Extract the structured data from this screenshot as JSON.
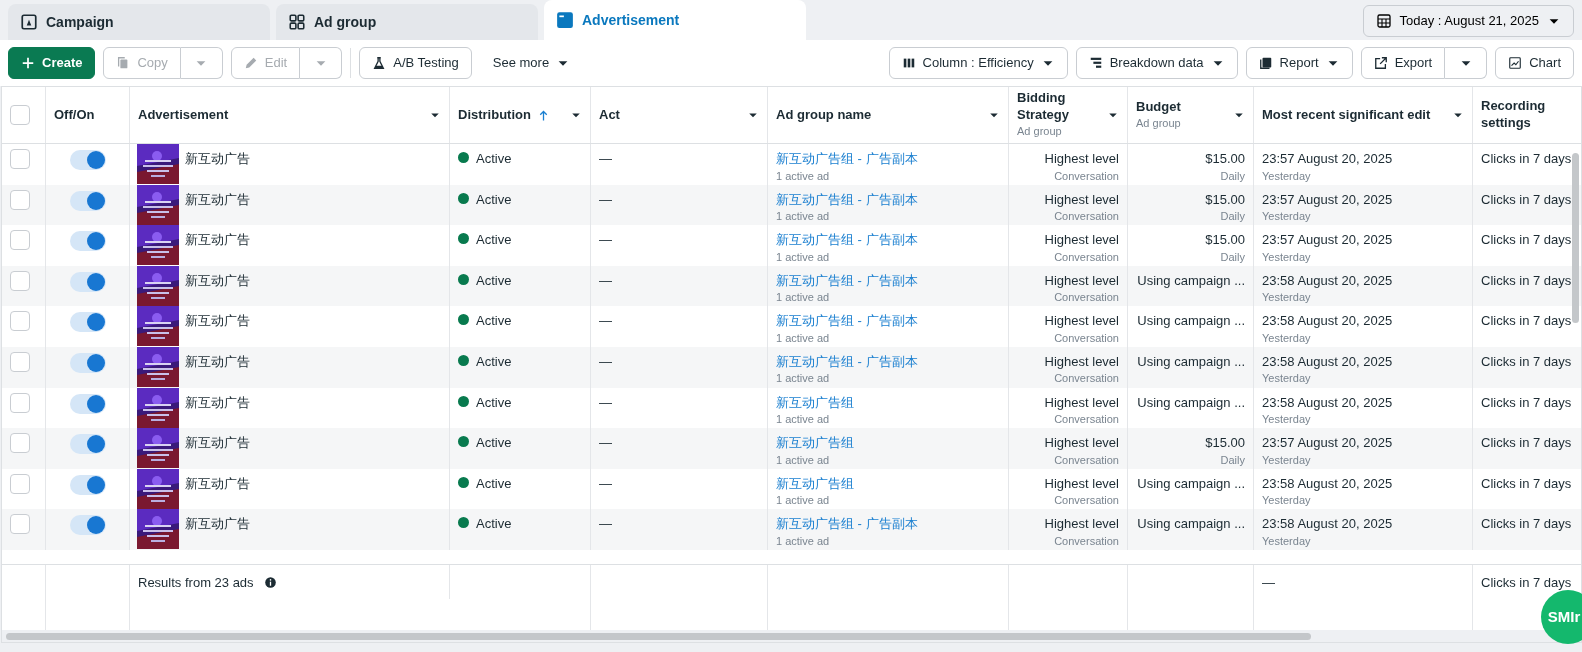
{
  "tabs": [
    {
      "label": "Campaign",
      "selected": false
    },
    {
      "label": "Ad group",
      "selected": false
    },
    {
      "label": "Advertisement",
      "selected": true
    }
  ],
  "date_button": {
    "label": "Today : August 21, 2025"
  },
  "toolbar_left": [
    {
      "label": "Create",
      "disabled": false
    },
    {
      "label": "Copy",
      "disabled": true
    },
    {
      "label": "Edit",
      "disabled": true
    },
    {
      "label": "A/B Testing",
      "disabled": false
    },
    {
      "label": "See more",
      "disabled": false
    }
  ],
  "toolbar_right": [
    {
      "label": "Column : Efficiency",
      "disabled": false
    },
    {
      "label": "Breakdown data",
      "disabled": false
    },
    {
      "label": "Report",
      "disabled": false
    },
    {
      "label": "Export",
      "disabled": false
    },
    {
      "label": "Chart",
      "disabled": false
    }
  ],
  "table": {
    "select_all": {
      "selected": false
    },
    "columns": [
      {
        "label": "Off/On",
        "dropdown": false
      },
      {
        "label": "Advertisement",
        "dropdown": true
      },
      {
        "label": "Distribution",
        "dropdown": true,
        "sorted": true
      },
      {
        "label": "Act",
        "dropdown": true
      },
      {
        "label": "Ad group name",
        "dropdown": true
      },
      {
        "label": "Bidding Strategy",
        "sub": "Ad group",
        "dropdown": true
      },
      {
        "label": "Budget",
        "sub": "Ad group",
        "dropdown": true
      },
      {
        "label": "Most recent significant edit",
        "dropdown": true
      },
      {
        "label": "Recording settings",
        "dropdown": false
      }
    ],
    "rows": [
      {
        "selected": false,
        "on": true,
        "name": "新互动广告",
        "status": "Active",
        "act": "—",
        "ad_group": "新互动广告组 - 广告副本",
        "ad_group_sub": "1 active ad",
        "bidding": "Highest level",
        "bidding_sub": "Conversation",
        "budget": "$15.00",
        "budget_sub": "Daily",
        "edit": "23:57 August 20, 2025",
        "edit_sub": "Yesterday",
        "recording": "Clicks in 7 days"
      },
      {
        "selected": false,
        "on": true,
        "name": "新互动广告",
        "status": "Active",
        "act": "—",
        "ad_group": "新互动广告组 - 广告副本",
        "ad_group_sub": "1 active ad",
        "bidding": "Highest level",
        "bidding_sub": "Conversation",
        "budget": "$15.00",
        "budget_sub": "Daily",
        "edit": "23:57 August 20, 2025",
        "edit_sub": "Yesterday",
        "recording": "Clicks in 7 days"
      },
      {
        "selected": false,
        "on": true,
        "name": "新互动广告",
        "status": "Active",
        "act": "—",
        "ad_group": "新互动广告组 - 广告副本",
        "ad_group_sub": "1 active ad",
        "bidding": "Highest level",
        "bidding_sub": "Conversation",
        "budget": "$15.00",
        "budget_sub": "Daily",
        "edit": "23:57 August 20, 2025",
        "edit_sub": "Yesterday",
        "recording": "Clicks in 7 days"
      },
      {
        "selected": false,
        "on": true,
        "name": "新互动广告",
        "status": "Active",
        "act": "—",
        "ad_group": "新互动广告组 - 广告副本",
        "ad_group_sub": "1 active ad",
        "bidding": "Highest level",
        "bidding_sub": "Conversation",
        "budget": "Using campaign ...",
        "edit": "23:58 August 20, 2025",
        "edit_sub": "Yesterday",
        "recording": "Clicks in 7 days"
      },
      {
        "selected": false,
        "on": true,
        "name": "新互动广告",
        "status": "Active",
        "act": "—",
        "ad_group": "新互动广告组 - 广告副本",
        "ad_group_sub": "1 active ad",
        "bidding": "Highest level",
        "bidding_sub": "Conversation",
        "budget": "Using campaign ...",
        "edit": "23:58 August 20, 2025",
        "edit_sub": "Yesterday",
        "recording": "Clicks in 7 days"
      },
      {
        "selected": false,
        "on": true,
        "name": "新互动广告",
        "status": "Active",
        "act": "—",
        "ad_group": "新互动广告组 - 广告副本",
        "ad_group_sub": "1 active ad",
        "bidding": "Highest level",
        "bidding_sub": "Conversation",
        "budget": "Using campaign ...",
        "edit": "23:58 August 20, 2025",
        "edit_sub": "Yesterday",
        "recording": "Clicks in 7 days"
      },
      {
        "selected": false,
        "on": true,
        "name": "新互动广告",
        "status": "Active",
        "act": "—",
        "ad_group": "新互动广告组",
        "ad_group_sub": "1 active ad",
        "bidding": "Highest level",
        "bidding_sub": "Conversation",
        "budget": "Using campaign ...",
        "edit": "23:58 August 20, 2025",
        "edit_sub": "Yesterday",
        "recording": "Clicks in 7 days"
      },
      {
        "selected": false,
        "on": true,
        "name": "新互动广告",
        "status": "Active",
        "act": "—",
        "ad_group": "新互动广告组",
        "ad_group_sub": "1 active ad",
        "bidding": "Highest level",
        "bidding_sub": "Conversation",
        "budget": "$15.00",
        "budget_sub": "Daily",
        "edit": "23:57 August 20, 2025",
        "edit_sub": "Yesterday",
        "recording": "Clicks in 7 days"
      },
      {
        "selected": false,
        "on": true,
        "name": "新互动广告",
        "status": "Active",
        "act": "—",
        "ad_group": "新互动广告组",
        "ad_group_sub": "1 active ad",
        "bidding": "Highest level",
        "bidding_sub": "Conversation",
        "budget": "Using campaign ...",
        "edit": "23:58 August 20, 2025",
        "edit_sub": "Yesterday",
        "recording": "Clicks in 7 days"
      },
      {
        "selected": false,
        "on": true,
        "name": "新互动广告",
        "status": "Active",
        "act": "—",
        "ad_group": "新互动广告组 - 广告副本",
        "ad_group_sub": "1 active ad",
        "bidding": "Highest level",
        "bidding_sub": "Conversation",
        "budget": "Using campaign ...",
        "edit": "23:58 August 20, 2025",
        "edit_sub": "Yesterday",
        "recording": "Clicks in 7 days"
      }
    ],
    "footer": {
      "results": "Results from 23 ads",
      "edit": "—",
      "recording": "Clicks in 7 days"
    }
  },
  "badge": {
    "label": "SMIr"
  }
}
